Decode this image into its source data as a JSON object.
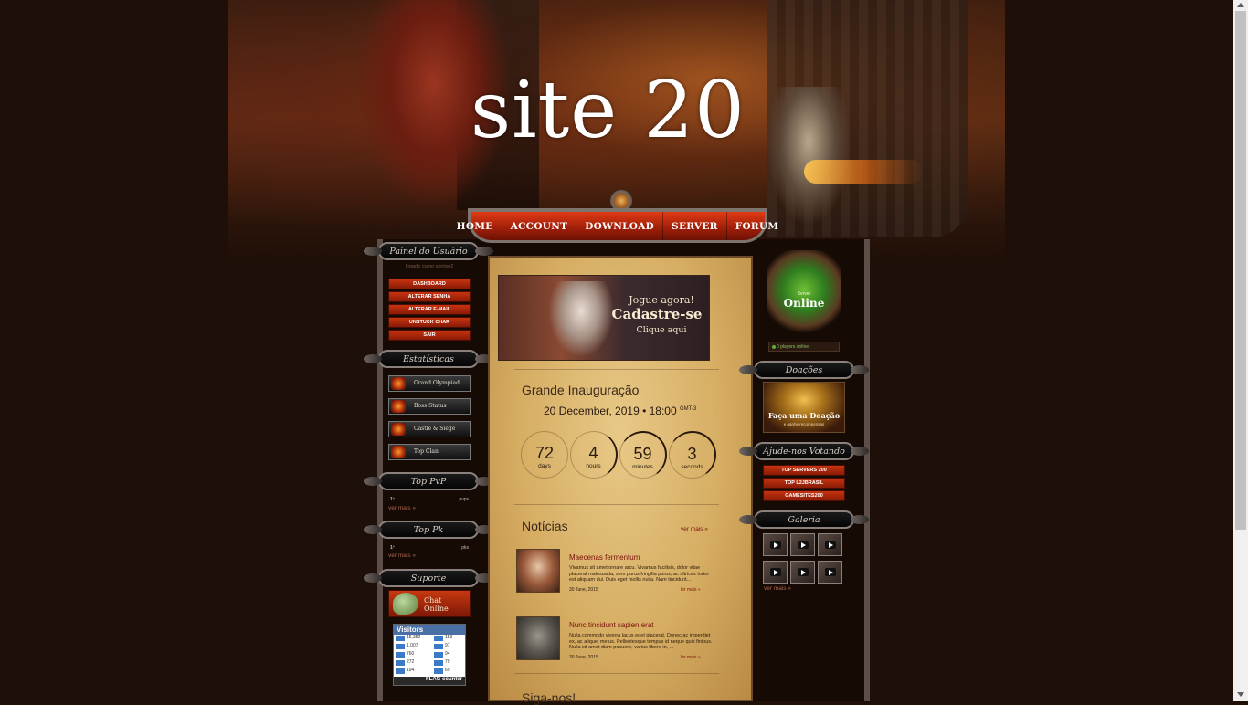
{
  "site": {
    "title": "site 20"
  },
  "nav": {
    "items": [
      {
        "label": "Home"
      },
      {
        "label": "Account"
      },
      {
        "label": "Download"
      },
      {
        "label": "Server"
      },
      {
        "label": "Forum"
      }
    ]
  },
  "user_panel": {
    "header": "Painel do Usuário",
    "logged_as": "logado como sorriso2",
    "items": [
      {
        "label": "Dashboard"
      },
      {
        "label": "Alterar Senha"
      },
      {
        "label": "Alterar E-mail"
      },
      {
        "label": "Unstuck Char"
      },
      {
        "label": "Sair"
      }
    ]
  },
  "statistics": {
    "header": "Estatísticas",
    "items": [
      {
        "label": "Grand Olympiad"
      },
      {
        "label": "Boss Status"
      },
      {
        "label": "Castle & Siege"
      },
      {
        "label": "Top Clan"
      }
    ]
  },
  "top_pvp": {
    "header": "Top PvP",
    "rank": "1º",
    "col": "pvps",
    "more": "ver mais »"
  },
  "top_pk": {
    "header": "Top Pk",
    "rank": "1º",
    "col": "pks",
    "more": "ver mais »"
  },
  "support": {
    "header": "Suporte",
    "chat_line1": "Chat",
    "chat_line2": "Online"
  },
  "visitors": {
    "title": "Visitors",
    "rows_left": [
      "15,352",
      "1,007",
      "760",
      "272",
      "194"
    ],
    "rows_right": [
      "153",
      "97",
      "94",
      "79",
      "69"
    ],
    "brand": "FLAG counter"
  },
  "banner": {
    "line1": "Jogue agora!",
    "line2": "Cadastre-se",
    "line3": "Clique aqui"
  },
  "opening": {
    "title": "Grande Inauguração",
    "date": "20 December, 2019 • 18:00",
    "tz": "GMT-3",
    "countdown": [
      {
        "value": "72",
        "label": "days"
      },
      {
        "value": "4",
        "label": "hours"
      },
      {
        "value": "59",
        "label": "minutes"
      },
      {
        "value": "3",
        "label": "seconds"
      }
    ]
  },
  "news": {
    "title": "Notícias",
    "more": "ver mais »",
    "items": [
      {
        "title": "Maecenas fermentum",
        "text": "Vivamus sit amet ornare arcu. Vivamus facilisis, dolor vitae placerat malesuada, sem purus fringilla purus, ac ultrices tortor est aliquam dui. Duis eget mollis nulla. Nam tincidunt...",
        "date": "30 June, 2015",
        "more": "ler mais »"
      },
      {
        "title": "Nunc tincidunt sapien erat",
        "text": "Nulla commodo viverra lacus eget placerat. Donec ac imperdiet ex, ac aliquet metus. Pellentesque tempus id neque quis finibus. Nulla sit amet diam posuere, varius libero in, ...",
        "date": "30 June, 2015",
        "more": "ler mais »"
      }
    ]
  },
  "follow": {
    "title": "Siga-nos!"
  },
  "server_status": {
    "label": "Server",
    "status": "Online",
    "players": "0 players online"
  },
  "donations": {
    "header": "Doações",
    "line1": "Faça uma Doação",
    "line2": "e ganhe recompensas"
  },
  "vote": {
    "header": "Ajude-nos Votando",
    "items": [
      {
        "label": "Top Servers 200"
      },
      {
        "label": "Top L2JBrasil"
      },
      {
        "label": "Gamesites200"
      }
    ]
  },
  "gallery": {
    "header": "Galeria",
    "more": "ver mais »"
  },
  "colors": {
    "accent": "#c8330f",
    "frame": "#5d4f48",
    "parchment": "#d6ad63"
  }
}
